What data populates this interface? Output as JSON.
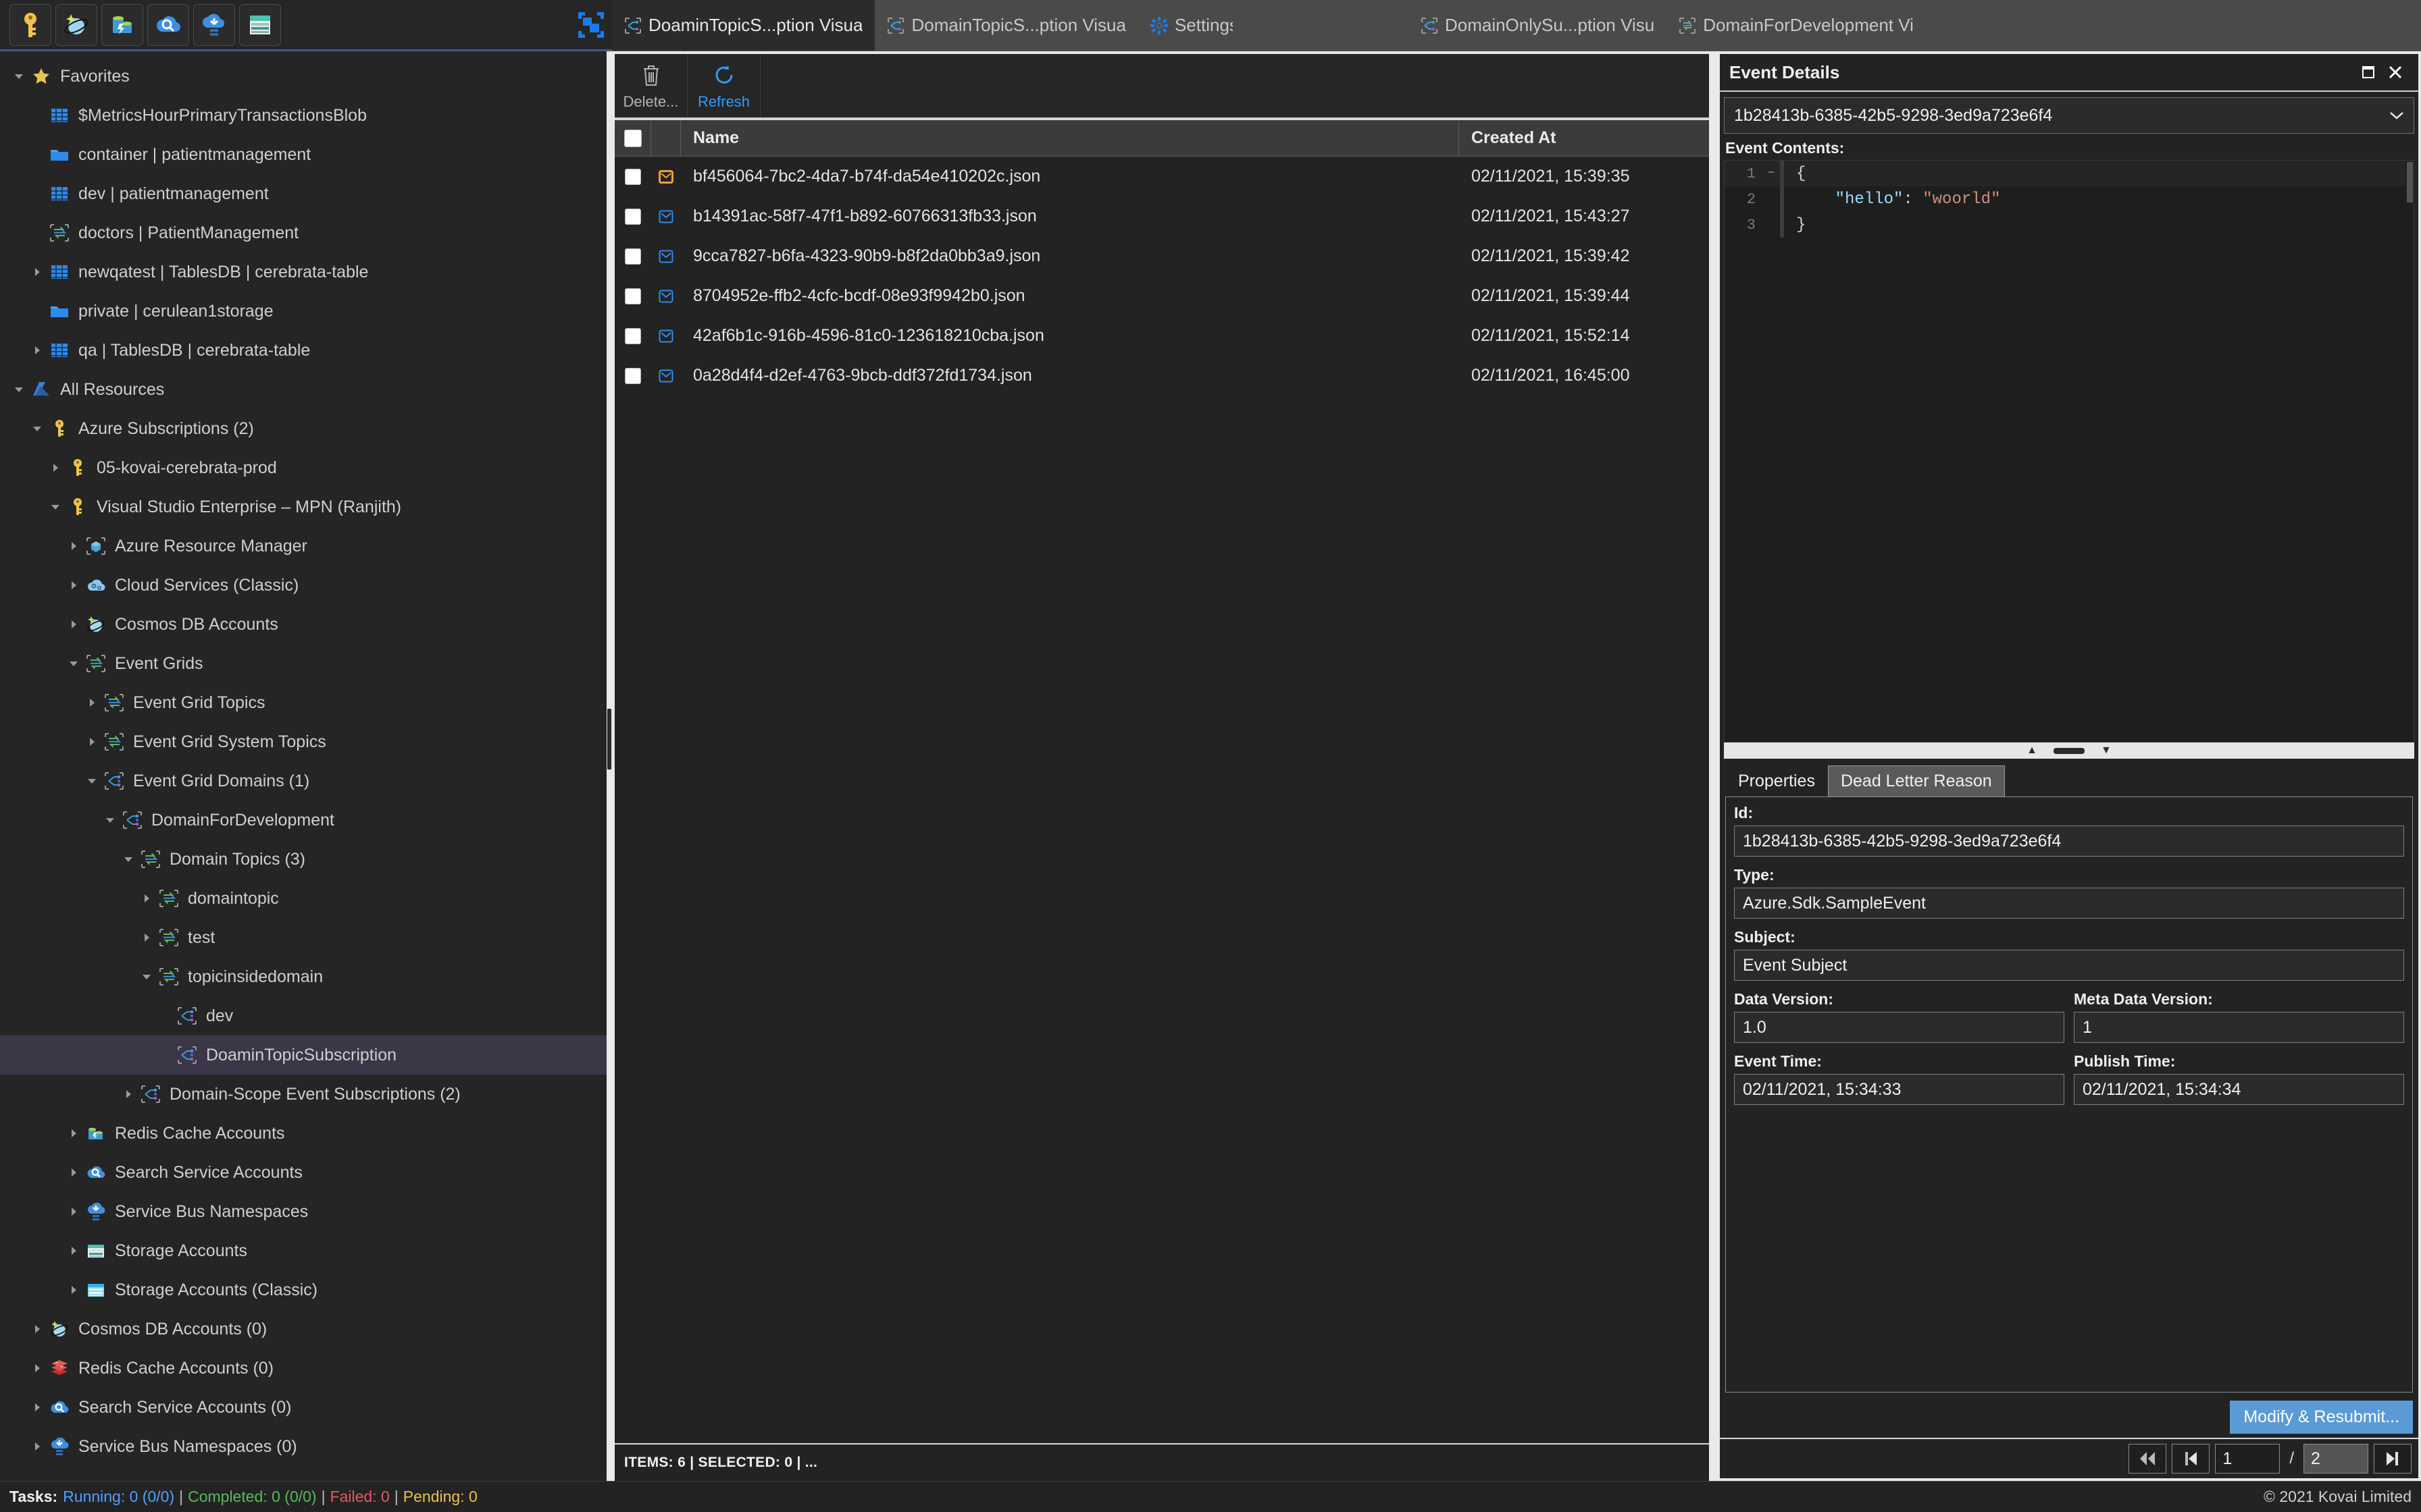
{
  "toolbar": {
    "buttons": [
      {
        "name": "key-icon",
        "label": "Key Vault"
      },
      {
        "name": "cosmos-db-icon",
        "label": "Cosmos DB"
      },
      {
        "name": "redis-cache-icon",
        "label": "Redis Cache"
      },
      {
        "name": "search-service-icon",
        "label": "Search Service"
      },
      {
        "name": "service-bus-icon",
        "label": "Service Bus"
      },
      {
        "name": "storage-account-icon",
        "label": "Storage Account"
      }
    ],
    "right_button": {
      "name": "layout-icon",
      "label": "Layout"
    }
  },
  "tabs": [
    {
      "label": "DoaminTopicS...ption Visua",
      "icon": "event-subscription-icon",
      "active": true
    },
    {
      "label": "DomainTopicS...ption Visua",
      "icon": "event-subscription-icon",
      "active": false
    },
    {
      "label": "Settings",
      "icon": "gear-icon",
      "active": false
    },
    {
      "label": "DomainOnlySu...ption Visu",
      "icon": "event-subscription-icon",
      "active": false
    },
    {
      "label": "DomainForDevelopment Vi",
      "icon": "event-grid-icon",
      "active": false
    }
  ],
  "sidebar": {
    "items": [
      {
        "label": "Favorites",
        "depth": 0,
        "twist": "down",
        "icon": "star-icon"
      },
      {
        "label": "$MetricsHourPrimaryTransactionsBlob",
        "depth": 1,
        "twist": "none",
        "icon": "table-icon"
      },
      {
        "label": "container | patientmanagement",
        "depth": 1,
        "twist": "none",
        "icon": "folder-icon"
      },
      {
        "label": "dev | patientmanagement",
        "depth": 1,
        "twist": "none",
        "icon": "table-icon"
      },
      {
        "label": "doctors | PatientManagement",
        "depth": 1,
        "twist": "none",
        "icon": "event-grid-icon"
      },
      {
        "label": "newqatest | TablesDB | cerebrata-table",
        "depth": 1,
        "twist": "right",
        "icon": "table-icon"
      },
      {
        "label": "private | cerulean1storage",
        "depth": 1,
        "twist": "none",
        "icon": "folder-icon"
      },
      {
        "label": "qa | TablesDB | cerebrata-table",
        "depth": 1,
        "twist": "right",
        "icon": "table-icon"
      },
      {
        "label": "All Resources",
        "depth": 0,
        "twist": "down",
        "icon": "azure-icon"
      },
      {
        "label": "Azure Subscriptions (2)",
        "depth": 1,
        "twist": "down",
        "icon": "key-icon"
      },
      {
        "label": "05-kovai-cerebrata-prod",
        "depth": 2,
        "twist": "right",
        "icon": "key-icon"
      },
      {
        "label": "Visual Studio Enterprise – MPN (Ranjith)",
        "depth": 2,
        "twist": "down",
        "icon": "key-icon"
      },
      {
        "label": "Azure Resource Manager",
        "depth": 3,
        "twist": "right",
        "icon": "arm-icon"
      },
      {
        "label": "Cloud Services (Classic)",
        "depth": 3,
        "twist": "right",
        "icon": "cloud-services-icon"
      },
      {
        "label": "Cosmos DB Accounts",
        "depth": 3,
        "twist": "right",
        "icon": "cosmos-db-icon"
      },
      {
        "label": "Event Grids",
        "depth": 3,
        "twist": "down",
        "icon": "event-grid-icon"
      },
      {
        "label": "Event Grid Topics",
        "depth": 4,
        "twist": "right",
        "icon": "event-grid-icon"
      },
      {
        "label": "Event Grid System Topics",
        "depth": 4,
        "twist": "right",
        "icon": "event-grid-icon"
      },
      {
        "label": "Event Grid Domains (1)",
        "depth": 4,
        "twist": "down",
        "icon": "event-domain-icon"
      },
      {
        "label": "DomainForDevelopment",
        "depth": 5,
        "twist": "down",
        "icon": "event-domain-icon"
      },
      {
        "label": "Domain Topics (3)",
        "depth": 6,
        "twist": "down",
        "icon": "event-grid-icon"
      },
      {
        "label": "domaintopic",
        "depth": 7,
        "twist": "right",
        "icon": "event-grid-icon"
      },
      {
        "label": "test",
        "depth": 7,
        "twist": "right",
        "icon": "event-grid-icon"
      },
      {
        "label": "topicinsidedomain",
        "depth": 7,
        "twist": "down",
        "icon": "event-grid-icon"
      },
      {
        "label": "dev",
        "depth": 8,
        "twist": "none",
        "icon": "event-subscription-icon"
      },
      {
        "label": "DoaminTopicSubscription",
        "depth": 8,
        "twist": "none",
        "icon": "event-subscription-icon",
        "selected": true
      },
      {
        "label": "Domain-Scope Event Subscriptions (2)",
        "depth": 6,
        "twist": "right",
        "icon": "event-subscription-icon"
      },
      {
        "label": "Redis Cache Accounts",
        "depth": 3,
        "twist": "right",
        "icon": "redis-cache-icon"
      },
      {
        "label": "Search Service Accounts",
        "depth": 3,
        "twist": "right",
        "icon": "search-service-icon"
      },
      {
        "label": "Service Bus Namespaces",
        "depth": 3,
        "twist": "right",
        "icon": "service-bus-icon"
      },
      {
        "label": "Storage Accounts",
        "depth": 3,
        "twist": "right",
        "icon": "storage-account-icon"
      },
      {
        "label": "Storage Accounts (Classic)",
        "depth": 3,
        "twist": "right",
        "icon": "storage-classic-icon"
      },
      {
        "label": "Cosmos DB Accounts (0)",
        "depth": 1,
        "twist": "right",
        "icon": "cosmos-db-icon"
      },
      {
        "label": "Redis Cache Accounts (0)",
        "depth": 1,
        "twist": "right",
        "icon": "redis-stack-icon"
      },
      {
        "label": "Search Service Accounts (0)",
        "depth": 1,
        "twist": "right",
        "icon": "search-service-icon"
      },
      {
        "label": "Service Bus Namespaces (0)",
        "depth": 1,
        "twist": "right",
        "icon": "service-bus-icon"
      }
    ]
  },
  "commands": {
    "delete_label": "Delete...",
    "refresh_label": "Refresh"
  },
  "grid": {
    "columns": [
      "Name",
      "Created At"
    ],
    "rows": [
      {
        "name": "bf456064-7bc2-4da7-b74f-da54e410202c.json",
        "created_at": "02/11/2021, 15:39:35",
        "checked": false,
        "current": true
      },
      {
        "name": "b14391ac-58f7-47f1-b892-60766313fb33.json",
        "created_at": "02/11/2021, 15:43:27",
        "checked": false,
        "current": false
      },
      {
        "name": "9cca7827-b6fa-4323-90b9-b8f2da0bb3a9.json",
        "created_at": "02/11/2021, 15:39:42",
        "checked": false,
        "current": false
      },
      {
        "name": "8704952e-ffb2-4cfc-bcdf-08e93f9942b0.json",
        "created_at": "02/11/2021, 15:39:44",
        "checked": false,
        "current": false
      },
      {
        "name": "42af6b1c-916b-4596-81c0-123618210cba.json",
        "created_at": "02/11/2021, 15:52:14",
        "checked": false,
        "current": false
      },
      {
        "name": "0a28d4f4-d2ef-4763-9bcb-ddf372fd1734.json",
        "created_at": "02/11/2021, 16:45:00",
        "checked": false,
        "current": false
      }
    ],
    "status": "ITEMS: 6 | SELECTED: 0 |  ..."
  },
  "event_details": {
    "title": "Event Details",
    "selected_event_id": "1b28413b-6385-42b5-9298-3ed9a723e6f4",
    "contents_label": "Event Contents:",
    "contents_lines": [
      {
        "no": "1",
        "fold": "−",
        "text": "{"
      },
      {
        "no": "2",
        "fold": "",
        "text": "    \"hello\": \"woorld\""
      },
      {
        "no": "3",
        "fold": "",
        "text": "}"
      }
    ],
    "json_key": "\"hello\"",
    "json_value": "\"woorld\"",
    "tabs": [
      {
        "label": "Properties",
        "active": true
      },
      {
        "label": "Dead Letter Reason",
        "active": false
      }
    ],
    "fields": {
      "id_label": "Id:",
      "id_value": "1b28413b-6385-42b5-9298-3ed9a723e6f4",
      "type_label": "Type:",
      "type_value": "Azure.Sdk.SampleEvent",
      "subject_label": "Subject:",
      "subject_value": "Event Subject",
      "data_version_label": "Data Version:",
      "data_version_value": "1.0",
      "meta_data_version_label": "Meta Data Version:",
      "meta_data_version_value": "1",
      "event_time_label": "Event Time:",
      "event_time_value": "02/11/2021, 15:34:33",
      "publish_time_label": "Publish Time:",
      "publish_time_value": "02/11/2021, 15:34:34"
    },
    "resubmit_label": "Modify & Resubmit..."
  },
  "pager": {
    "first_label": "◀◀",
    "prev_label": "▐◀",
    "current_page": "1",
    "separator": "/",
    "total_pages": "2",
    "next_label": "▶▌"
  },
  "statusbar": {
    "tasks_label": "Tasks:",
    "running": "Running: 0 (0/0)",
    "completed": "Completed: 0 (0/0)",
    "failed": "Failed: 0",
    "pending": "Pending: 0",
    "copyright": "© 2021 Kovai Limited"
  },
  "colors": {
    "accent_blue": "#2f9bff",
    "button_blue": "#5b9bd5",
    "selection": "#3b3747",
    "running": "#4ea1ff",
    "completed": "#5cb85c",
    "failed": "#e05c5c",
    "pending": "#e8c34a"
  }
}
